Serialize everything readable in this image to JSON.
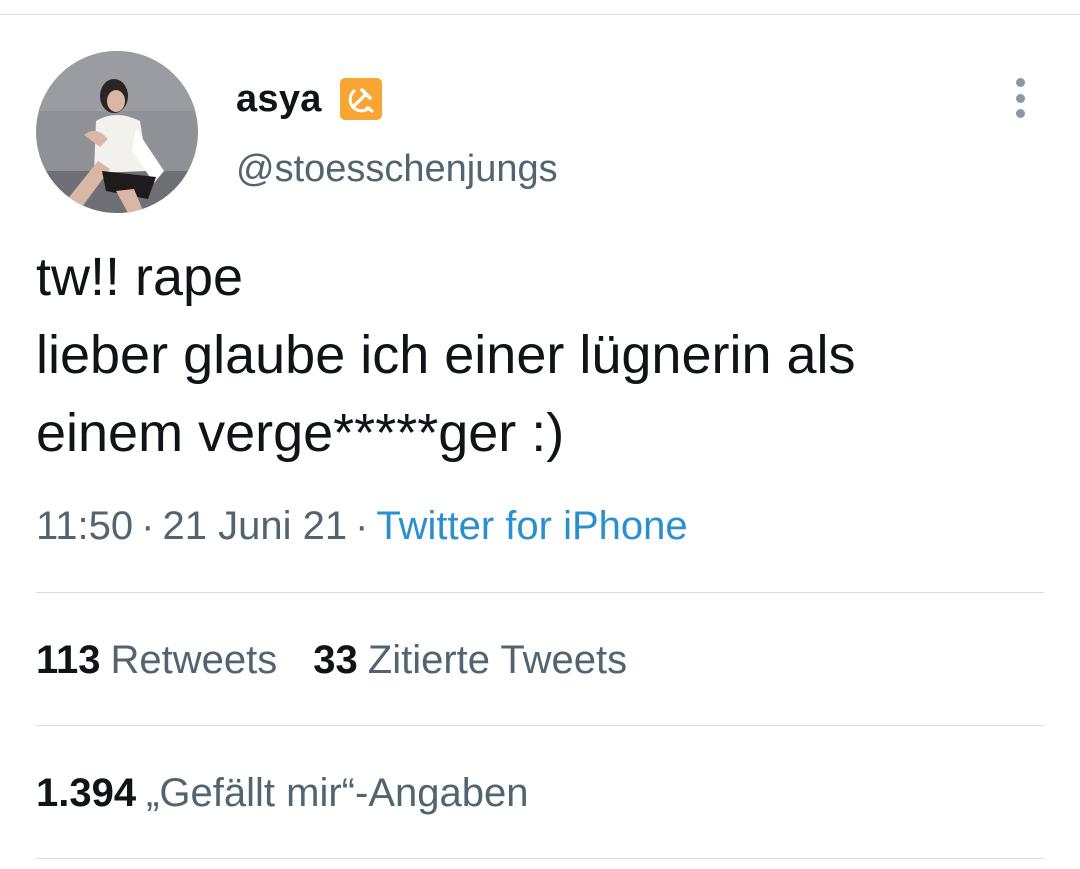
{
  "tweet": {
    "display_name": "asya",
    "name_emoji": "hammer-and-sickle-emoji",
    "handle": "@stoesschenjungs",
    "text_lines": [
      "tw!! rape",
      "lieber glaube ich einer lügnerin als",
      "einem verge*****ger :)"
    ],
    "time": "11:50",
    "date": "21 Juni 21",
    "source": "Twitter for iPhone",
    "separator": "·"
  },
  "stats": {
    "retweets_count": "113",
    "retweets_label": "Retweets",
    "quotes_count": "33",
    "quotes_label": "Zitierte Tweets",
    "likes_count": "1.394",
    "likes_label": "„Gefällt mir“-Angaben"
  },
  "icons": {
    "more": "more-options-icon",
    "avatar": "profile-avatar"
  },
  "colors": {
    "text_primary": "#0f1419",
    "text_secondary": "#536471",
    "link": "#2a8fd0",
    "divider": "#d9dde1",
    "emoji_bg": "#f7a533"
  }
}
